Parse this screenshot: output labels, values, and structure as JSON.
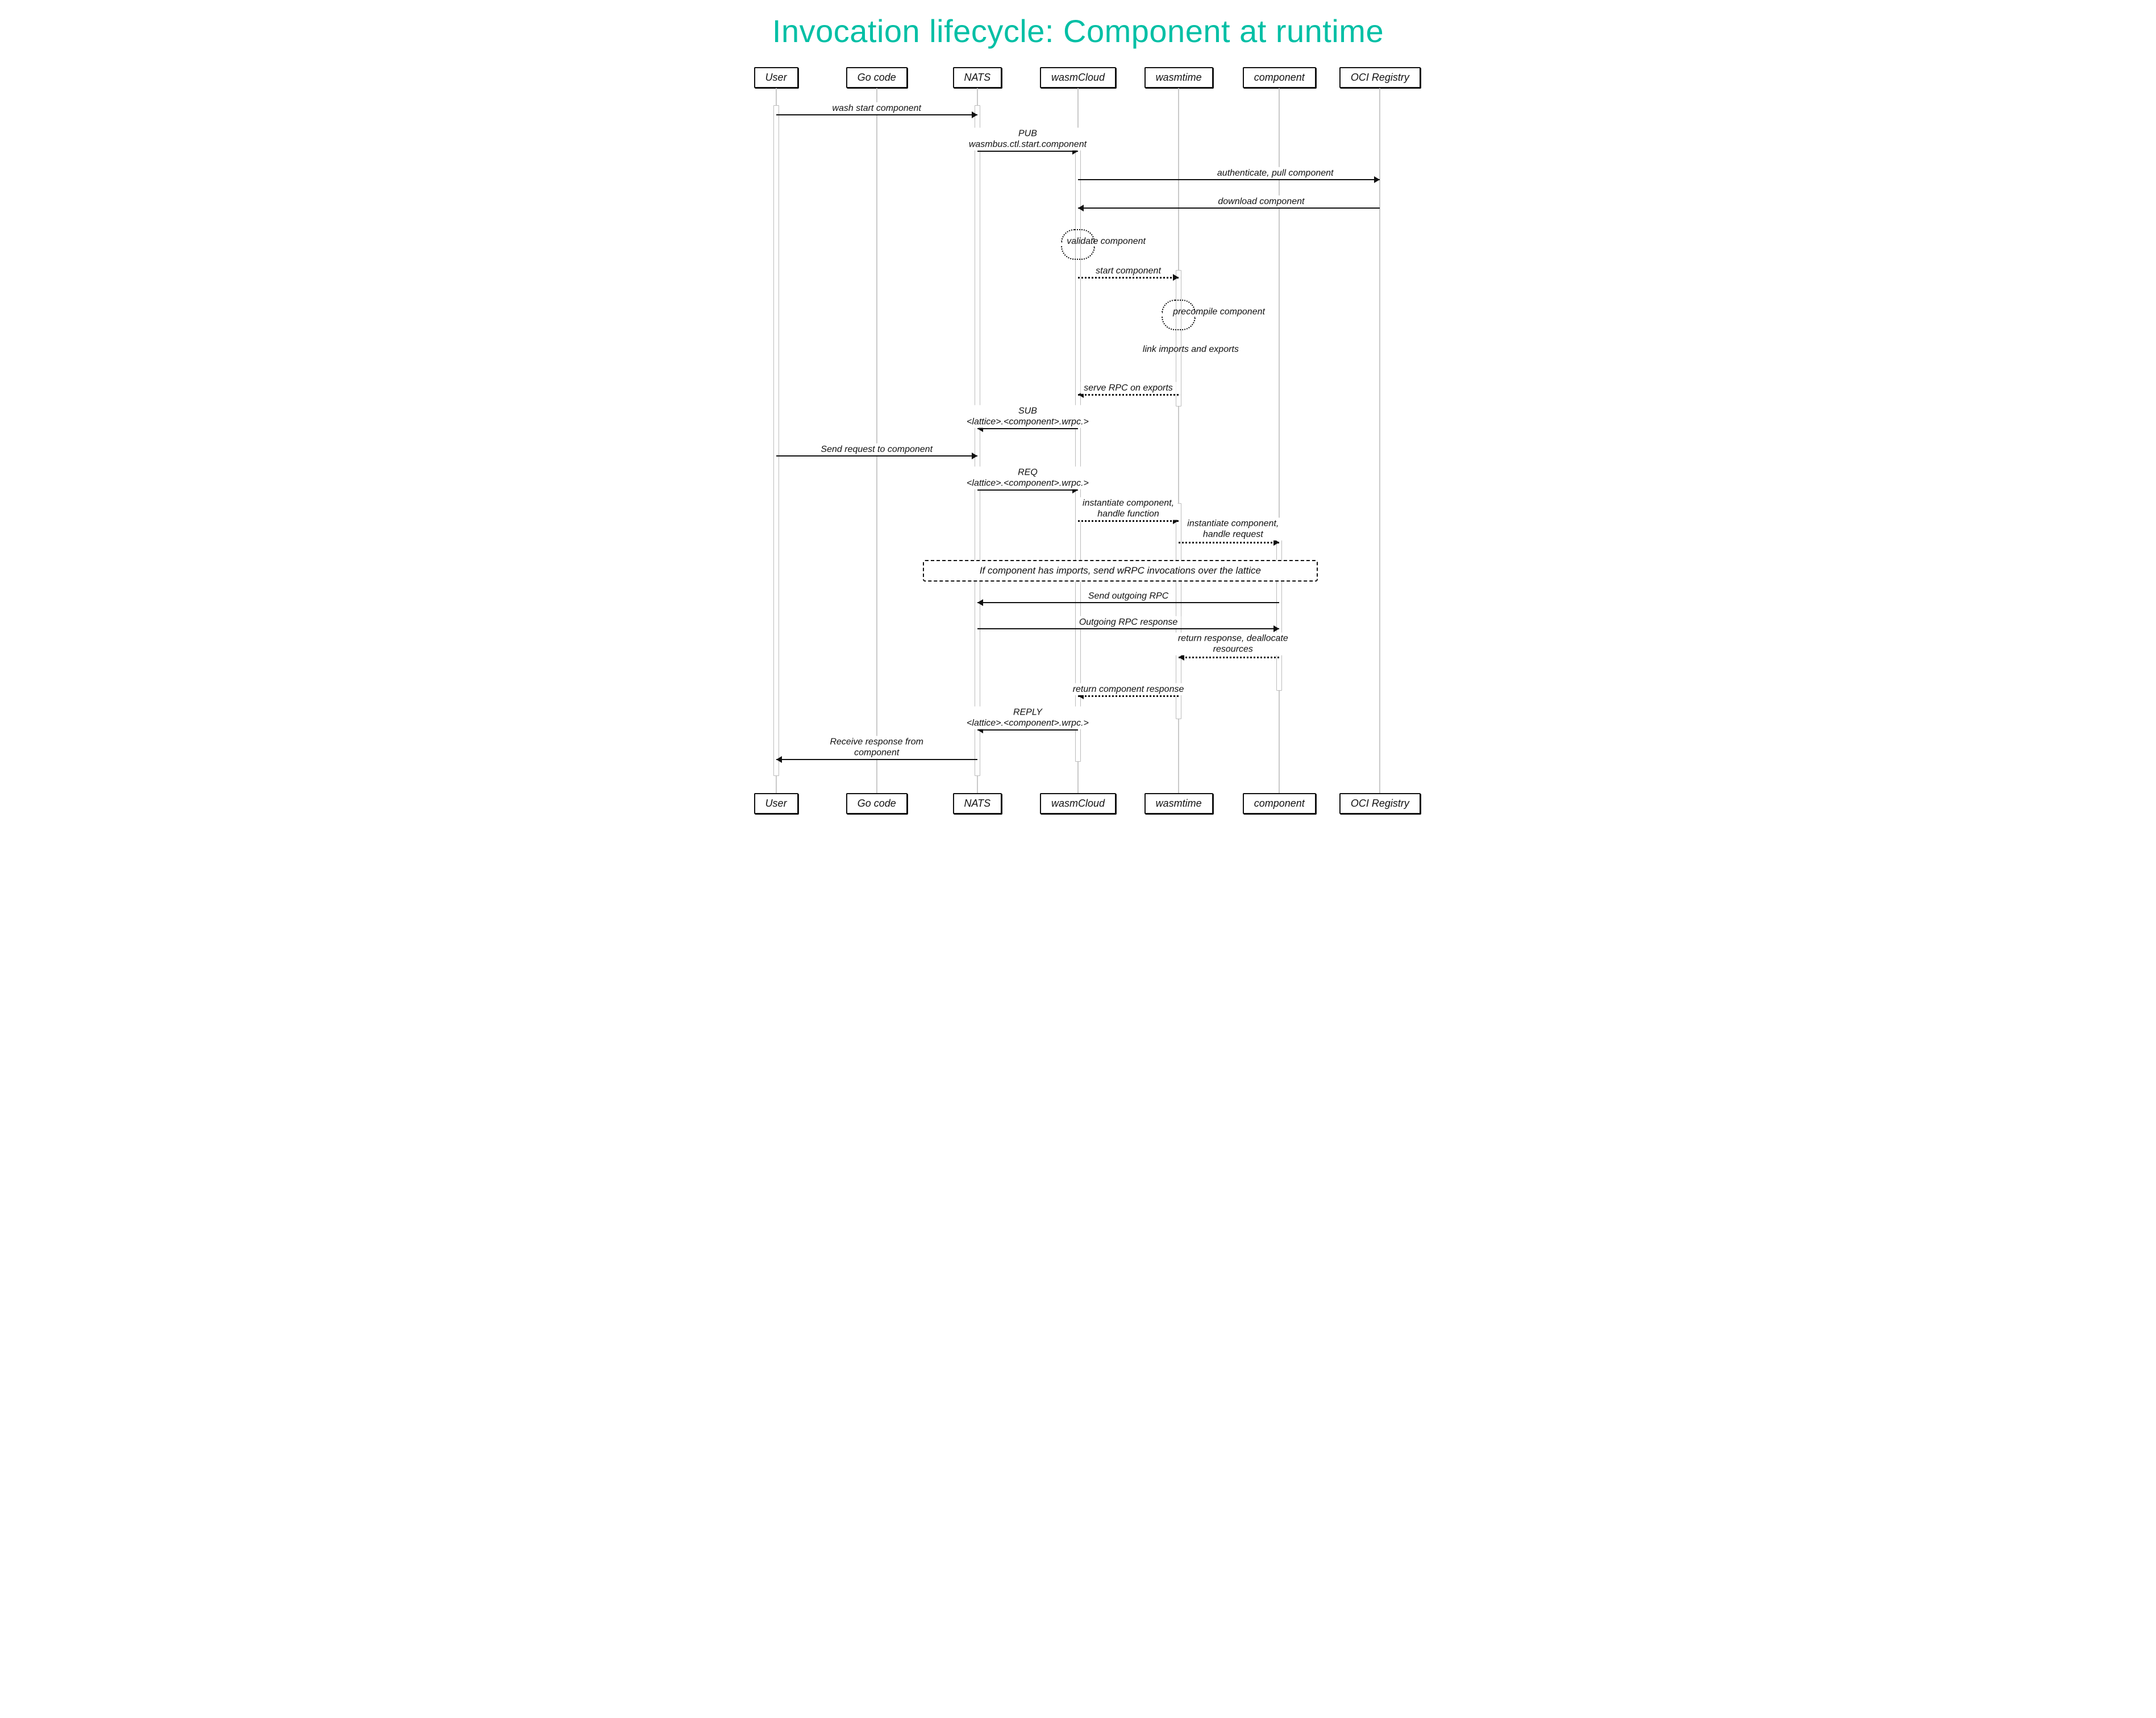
{
  "title": "Invocation lifecycle:\nComponent at runtime",
  "participants": [
    "User",
    "Go code",
    "NATS",
    "wasmCloud",
    "wasmtime",
    "component",
    "OCI Registry"
  ],
  "messages": {
    "m1": "wash start component",
    "m2": "PUB\nwasmbus.ctl.start.component",
    "m3": "authenticate, pull component",
    "m4": "download component",
    "m5": "validate component",
    "m6": "start component",
    "m7": "precompile component",
    "m8": "link imports and\nexports",
    "m9": "serve RPC on exports",
    "m10": "SUB\n<lattice>.<component>.wrpc.>",
    "m11": "Send request to component",
    "m12": "REQ\n<lattice>.<component>.wrpc.>",
    "m13": "instantiate component,\nhandle function",
    "m14": "instantiate component,\nhandle request",
    "m15": "If component has imports, send wRPC invocations over the lattice",
    "m16": "Send outgoing RPC",
    "m17": "Outgoing RPC response",
    "m18": "return response, deallocate\nresources",
    "m19": "return component response",
    "m20": "REPLY\n<lattice>.<component>.wrpc.>",
    "m21": "Receive response from component"
  }
}
